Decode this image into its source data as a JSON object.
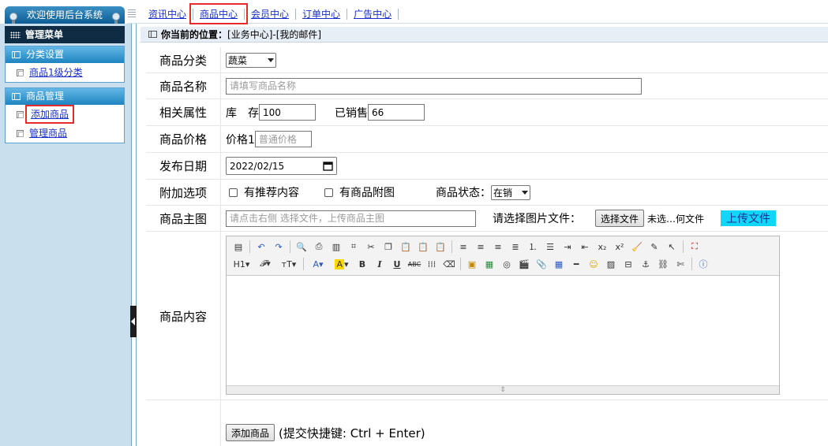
{
  "topbar": {
    "brand_title": "欢迎使用后台系统",
    "nav": [
      "资讯中心",
      "商品中心",
      "会员中心",
      "订单中心",
      "广告中心"
    ],
    "active_nav": "商品中心"
  },
  "sidebar": {
    "menu_title": "管理菜单",
    "groups": [
      {
        "title": "分类设置",
        "items": [
          "商品1级分类"
        ]
      },
      {
        "title": "商品管理",
        "items": [
          "添加商品",
          "管理商品"
        ]
      }
    ]
  },
  "breadcrumb": {
    "label": "你当前的位置：",
    "path": "[业务中心]-[我的邮件]"
  },
  "form": {
    "category": {
      "label": "商品分类",
      "selected": "蔬菜"
    },
    "name": {
      "label": "商品名称",
      "placeholder": "请填写商品名称"
    },
    "attrs": {
      "label": "相关属性",
      "stock_label": "库　存",
      "stock_value": "100",
      "sold_label": "已销售",
      "sold_value": "66"
    },
    "price": {
      "label": "商品价格",
      "price_label": "价格1",
      "placeholder": "普通价格"
    },
    "date": {
      "label": "发布日期",
      "value": "2022/02/15"
    },
    "options": {
      "label": "附加选项",
      "opt1": "有推荐内容",
      "opt2": "有商品附图",
      "status_label": "商品状态：",
      "status_value": "在销"
    },
    "image": {
      "label": "商品主图",
      "placeholder": "请点击右侧 选择文件，上传商品主图",
      "choose_label": "请选择图片文件：",
      "choose_button": "选择文件",
      "no_file": "未选…何文件",
      "upload_button": "上传文件"
    },
    "content": {
      "label": "商品内容"
    },
    "submit": {
      "button": "添加商品",
      "hint": "(提交快捷键: Ctrl + Enter)"
    }
  },
  "colors": {
    "accent": "#1e84c0",
    "highlight": "#e52b2b",
    "upload": "#10d6f7"
  }
}
